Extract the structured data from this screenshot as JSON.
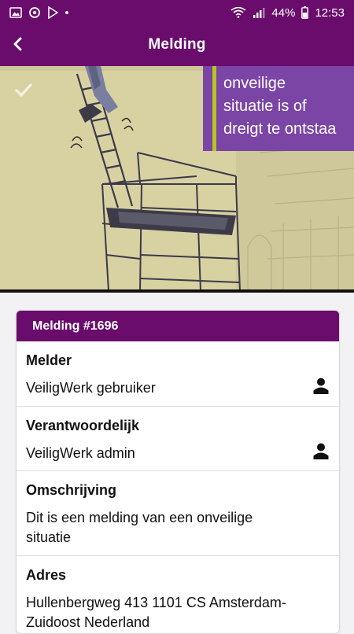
{
  "statusbar": {
    "battery": "44%",
    "time": "12:53"
  },
  "toolbar": {
    "title": "Melding"
  },
  "hero": {
    "lines": [
      "onveilige",
      "situatie is of",
      "dreigt te ontstaa"
    ]
  },
  "card": {
    "header": "Melding #1696",
    "sections": [
      {
        "label": "Melder",
        "value": "VeiligWerk gebruiker",
        "icon": "person-icon"
      },
      {
        "label": "Verantwoordelijk",
        "value": "VeiligWerk admin",
        "icon": "person-icon"
      },
      {
        "label": "Omschrijving",
        "value": "Dit is een melding van een onveilige situatie"
      },
      {
        "label": "Adres",
        "value": "Hullenbergweg 413 1101 CS Amsterdam-Zuidoost Nederland"
      }
    ]
  },
  "colors": {
    "primary": "#6a0c6c",
    "banner": "#7b45a6",
    "accent": "#b7c41f"
  }
}
